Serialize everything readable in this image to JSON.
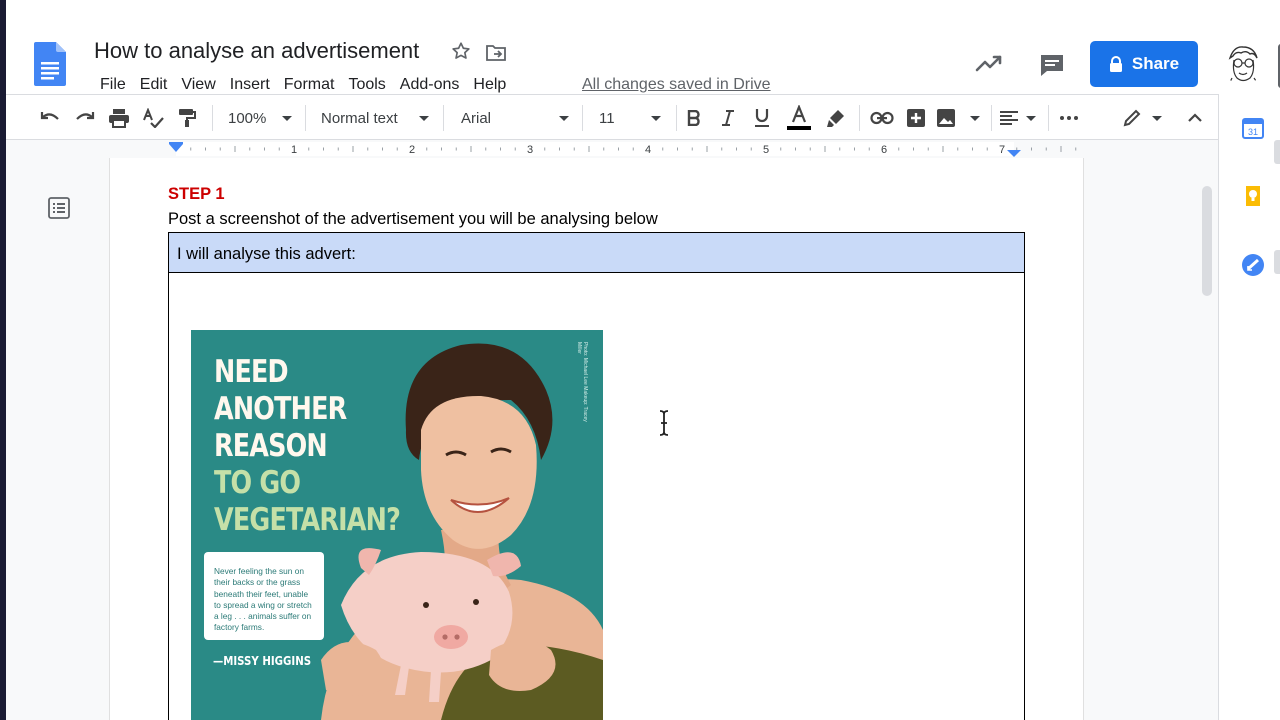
{
  "document": {
    "title": "How to analyse an advertisement",
    "save_status": "All changes saved in Drive"
  },
  "menu": [
    {
      "label": "File"
    },
    {
      "label": "Edit"
    },
    {
      "label": "View"
    },
    {
      "label": "Insert"
    },
    {
      "label": "Format"
    },
    {
      "label": "Tools"
    },
    {
      "label": "Add-ons"
    },
    {
      "label": "Help"
    }
  ],
  "header": {
    "share_label": "Share"
  },
  "toolbar": {
    "zoom": "100%",
    "style": "Normal text",
    "font": "Arial",
    "font_size": "11"
  },
  "ruler": {
    "labels": [
      "1",
      "2",
      "3",
      "4",
      "5",
      "6",
      "7"
    ]
  },
  "body": {
    "step_heading": "STEP 1",
    "instruction": "Post a screenshot of the advertisement you will be analysing below",
    "table_header": "I will analyse this advert:"
  },
  "advert": {
    "headline_lines": [
      "NEED",
      "ANOTHER",
      "REASON",
      "TO GO",
      "VEGETARIAN?"
    ],
    "quote": "Never feeling the sun on their backs or the grass beneath their feet, unable to spread a wing or stretch a leg . . . animals suffer on factory farms.",
    "author": "—MISSY HIGGINS",
    "credit": "Photo: Michael Lee    Makeup: Tracey Miller"
  },
  "side_panel": {
    "calendar_day": "31"
  },
  "colors": {
    "accent": "#1a73e8",
    "step_red": "#cc0000",
    "table_header_bg": "#c9daf8",
    "advert_teal": "#2a8a86"
  }
}
